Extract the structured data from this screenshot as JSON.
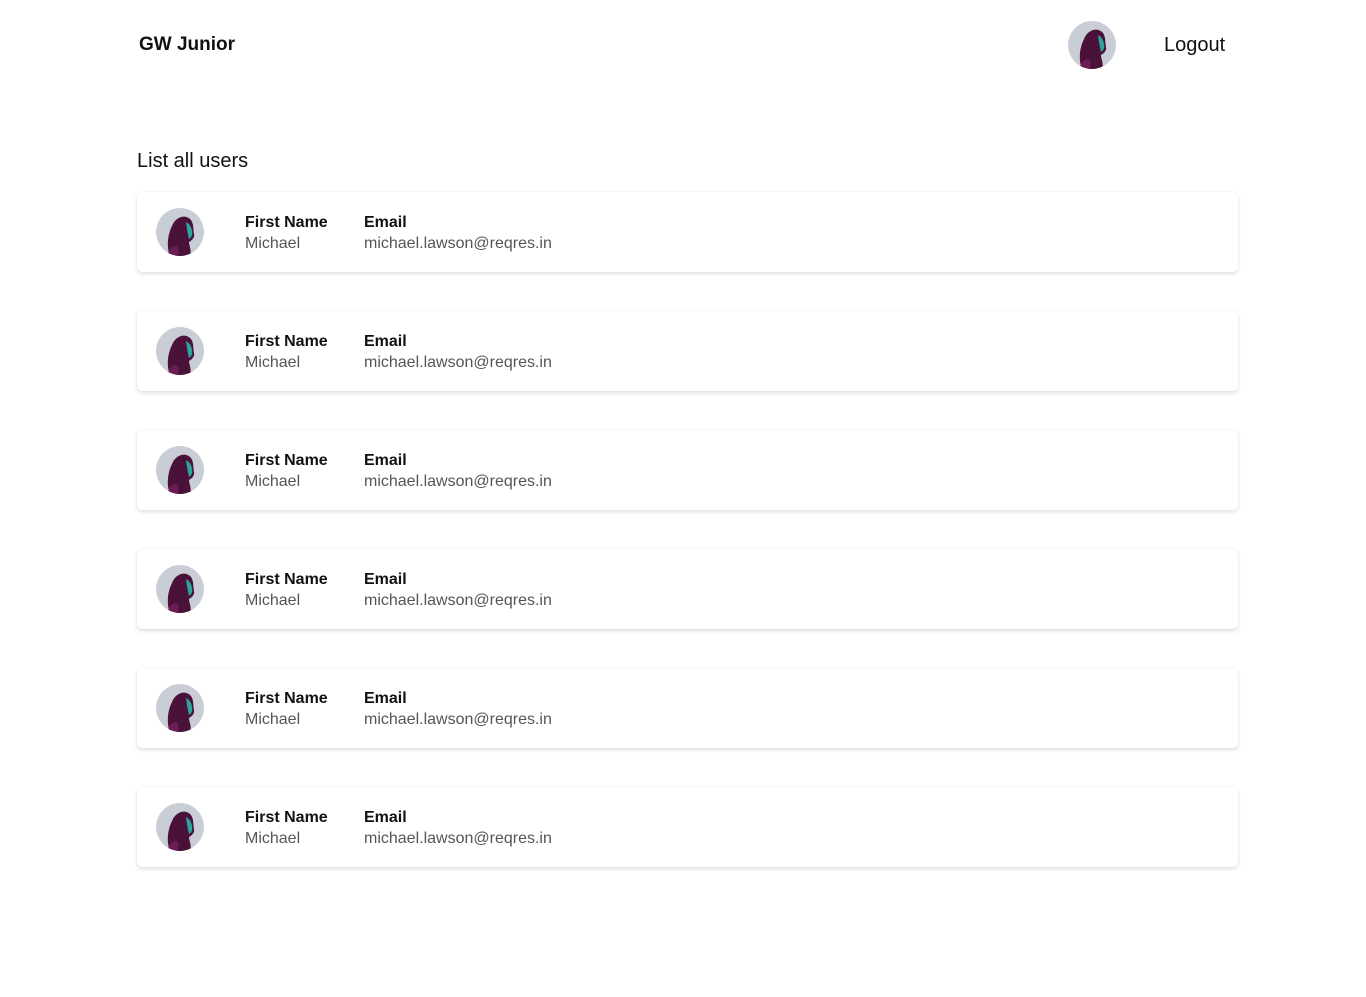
{
  "header": {
    "brand": "GW Junior",
    "logout_label": "Logout",
    "avatar_icon": "user-avatar-icon"
  },
  "main": {
    "title": "List all users",
    "users": [
      {
        "first_name_label": "First Name",
        "first_name": "Michael",
        "email_label": "Email",
        "email": "michael.lawson@reqres.in"
      },
      {
        "first_name_label": "First Name",
        "first_name": "Michael",
        "email_label": "Email",
        "email": "michael.lawson@reqres.in"
      },
      {
        "first_name_label": "First Name",
        "first_name": "Michael",
        "email_label": "Email",
        "email": "michael.lawson@reqres.in"
      },
      {
        "first_name_label": "First Name",
        "first_name": "Michael",
        "email_label": "Email",
        "email": "michael.lawson@reqres.in"
      },
      {
        "first_name_label": "First Name",
        "first_name": "Michael",
        "email_label": "Email",
        "email": "michael.lawson@reqres.in"
      },
      {
        "first_name_label": "First Name",
        "first_name": "Michael",
        "email_label": "Email",
        "email": "michael.lawson@reqres.in"
      }
    ]
  },
  "colors": {
    "text": "#111111",
    "muted": "#555555",
    "avatar_bg": "#c9cdd6",
    "avatar_face": "#5a1a4a",
    "avatar_accent": "#2fa3a0"
  }
}
